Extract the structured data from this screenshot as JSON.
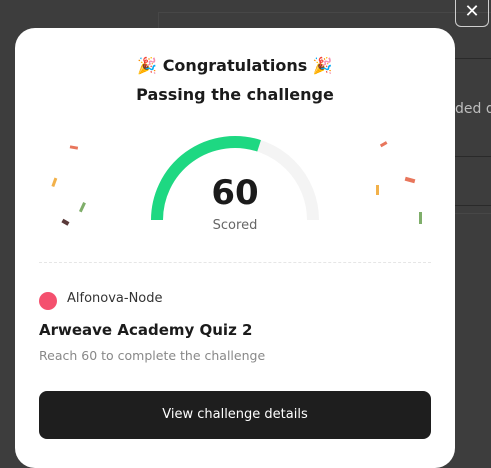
{
  "background": {
    "partial_text": "ded d"
  },
  "close_glyph": "✕",
  "modal": {
    "title": "Congratulations",
    "party_emoji": "🎉",
    "subtitle": "Passing the challenge",
    "score": "60",
    "score_value": 60,
    "score_max": 100,
    "score_label": "Scored",
    "organization": "Alfonova-Node",
    "quiz_title": "Arweave Academy Quiz 2",
    "description": "Reach 60 to complete the challenge",
    "button_label": "View challenge details"
  },
  "colors": {
    "gauge_fill": "#1ed882",
    "gauge_track": "#f4f4f4",
    "accent": "#f4506e",
    "button": "#1e1e1e"
  }
}
